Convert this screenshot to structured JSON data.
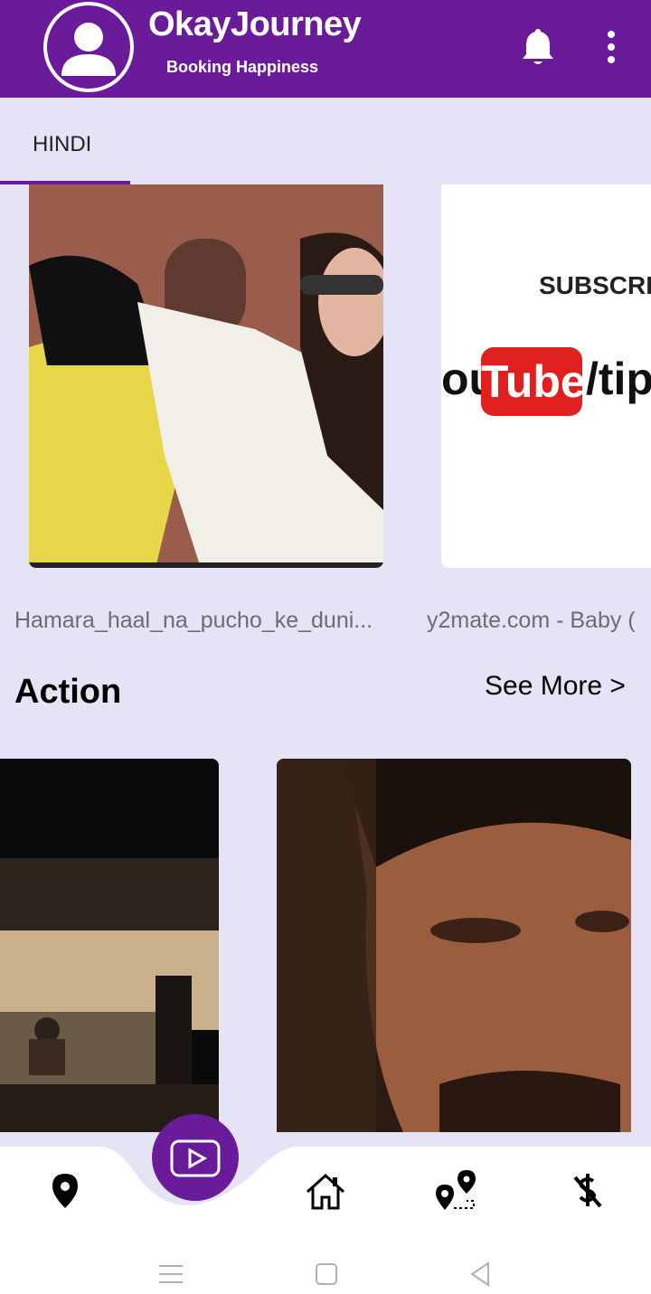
{
  "header": {
    "title": "OkayJourney",
    "subtitle": "Booking Happiness",
    "avatar_icon": "user-avatar-icon",
    "notification_icon": "bell-icon",
    "menu_icon": "more-vert-icon"
  },
  "tabs": [
    {
      "label": "HINDI",
      "selected": true
    }
  ],
  "hindi_videos": [
    {
      "title": "Hamara_haal_na_pucho_ke_duniya_ko_kya_laga",
      "title_display": "Hamara_haal_na_pucho_ke_duni..."
    },
    {
      "title": "y2mate.com - Baby (",
      "thumb_text_top": "SUBSCRIB",
      "thumb_text_left": "ou",
      "thumb_text_logo": "Tube",
      "thumb_text_right": "/tip"
    }
  ],
  "action_section": {
    "title": "Action",
    "see_more": "See More >"
  },
  "bottom_nav": {
    "items": [
      "location-pin-icon",
      "play-video-icon",
      "home-icon",
      "route-icon",
      "no-money-icon"
    ]
  },
  "system_nav": [
    "menu-icon",
    "square-home-icon",
    "back-triangle-icon"
  ],
  "colors": {
    "primary": "#6a1b9a",
    "background": "#e4e4f6",
    "youtube_red": "#e0201e"
  }
}
